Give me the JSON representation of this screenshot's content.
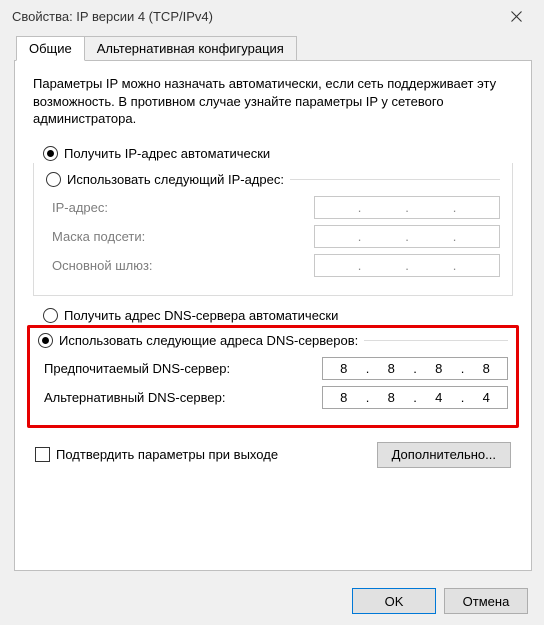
{
  "window": {
    "title": "Свойства: IP версии 4 (TCP/IPv4)"
  },
  "tabs": {
    "general": "Общие",
    "alternate": "Альтернативная конфигурация"
  },
  "intro": "Параметры IP можно назначать автоматически, если сеть поддерживает эту возможность. В противном случае узнайте параметры IP у сетевого администратора.",
  "ip_section": {
    "auto_label": "Получить IP-адрес автоматически",
    "manual_label": "Использовать следующий IP-адрес:",
    "ip_label": "IP-адрес:",
    "mask_label": "Маска подсети:",
    "gateway_label": "Основной шлюз:",
    "ip_value": [
      "",
      "",
      "",
      ""
    ],
    "mask_value": [
      "",
      "",
      "",
      ""
    ],
    "gateway_value": [
      "",
      "",
      "",
      ""
    ]
  },
  "dns_section": {
    "auto_label": "Получить адрес DNS-сервера автоматически",
    "manual_label": "Использовать следующие адреса DNS-серверов:",
    "preferred_label": "Предпочитаемый DNS-сервер:",
    "alternate_label": "Альтернативный DNS-сервер:",
    "preferred_value": [
      "8",
      "8",
      "8",
      "8"
    ],
    "alternate_value": [
      "8",
      "8",
      "4",
      "4"
    ]
  },
  "validate_label": "Подтвердить параметры при выходе",
  "advanced_label": "Дополнительно...",
  "ok_label": "OK",
  "cancel_label": "Отмена",
  "dot": "."
}
